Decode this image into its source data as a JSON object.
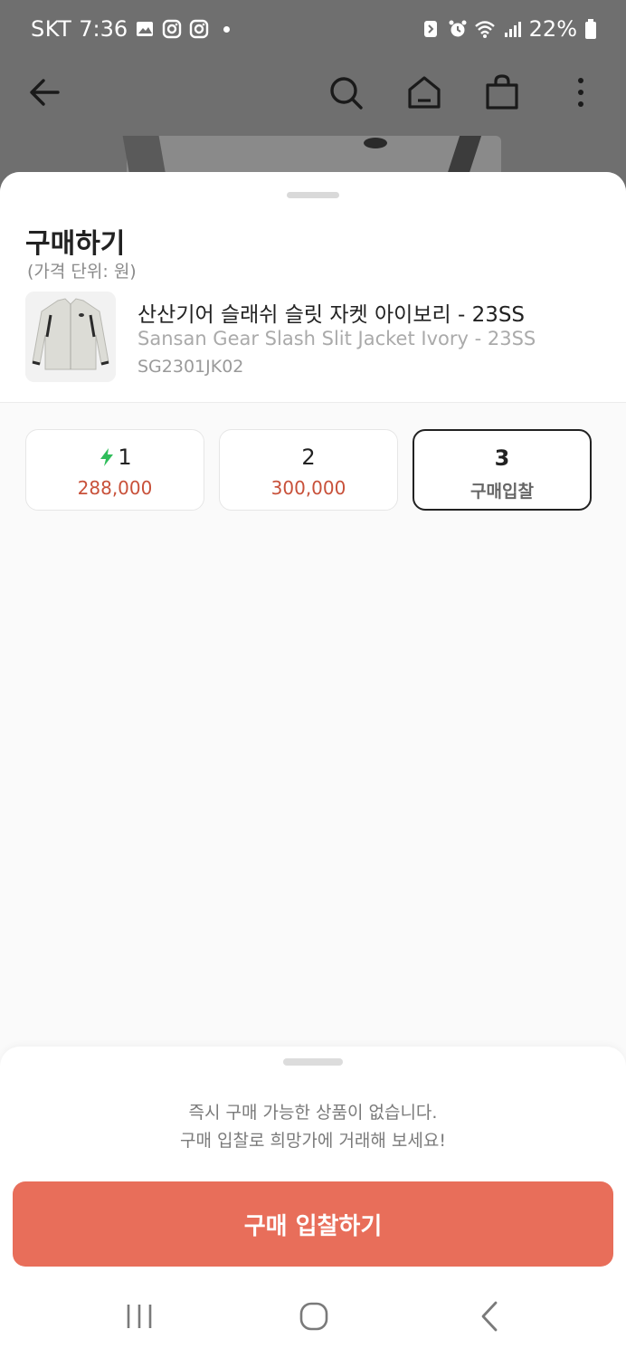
{
  "status_bar": {
    "carrier": "SKT",
    "time": "7:36",
    "battery": "22%"
  },
  "top_nav": {
    "icons": [
      "back-arrow-icon",
      "search-icon",
      "home-icon",
      "shopping-bag-icon",
      "more-vertical-icon"
    ]
  },
  "sheet": {
    "title": "구매하기",
    "subtitle": "(가격 단위: 원)"
  },
  "product": {
    "name_ko": "산산기어 슬래쉬 슬릿 자켓 아이보리 - 23SS",
    "name_en": "Sansan Gear Slash Slit Jacket Ivory - 23SS",
    "code": "SG2301JK02"
  },
  "sizes": [
    {
      "size": "1",
      "price": "288,000",
      "fast": true,
      "selected": false
    },
    {
      "size": "2",
      "price": "300,000",
      "fast": false,
      "selected": false
    },
    {
      "size": "3",
      "price": "구매입찰",
      "fast": false,
      "selected": true
    }
  ],
  "footer": {
    "notice_line1": "즉시 구매 가능한 상품이 없습니다.",
    "notice_line2": "구매 입찰로 희망가에 거래해 보세요!",
    "bid_button": "구매 입찰하기"
  },
  "colors": {
    "accent": "#e86e5a",
    "price": "#c8513a",
    "fast_bolt": "#2fbd5a"
  }
}
